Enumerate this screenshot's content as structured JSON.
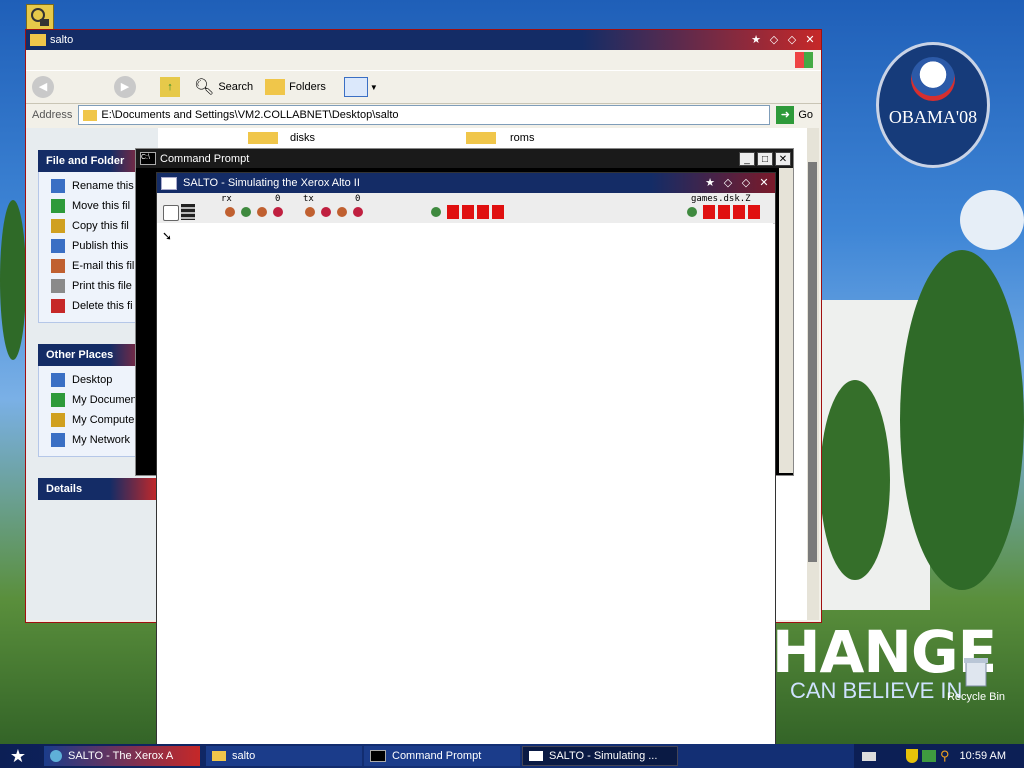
{
  "desktop": {
    "recycle_bin_label": "Recycle Bin",
    "poster_change": "HANGE",
    "poster_believe": "CAN BELIEVE IN",
    "badge_text": "OBAMA'08"
  },
  "explorer": {
    "title": "salto",
    "toolbar": {
      "search": "Search",
      "folders": "Folders"
    },
    "address_label": "Address",
    "address_value": "E:\\Documents and Settings\\VM2.COLLABNET\\Desktop\\salto",
    "go_label": "Go",
    "folders": [
      "disks",
      "roms"
    ],
    "file_tasks": {
      "header": "File and Folder",
      "items": [
        {
          "label": "Rename this",
          "icon": "rename-icon"
        },
        {
          "label": "Move this fil",
          "icon": "move-icon"
        },
        {
          "label": "Copy this fil",
          "icon": "copy-icon"
        },
        {
          "label": "Publish this",
          "icon": "publish-icon"
        },
        {
          "label": "E-mail this fil",
          "icon": "email-icon"
        },
        {
          "label": "Print this file",
          "icon": "print-icon"
        },
        {
          "label": "Delete this fi",
          "icon": "delete-icon"
        }
      ]
    },
    "other_places": {
      "header": "Other Places",
      "items": [
        {
          "label": "Desktop",
          "icon": "desktop-icon"
        },
        {
          "label": "My Documen",
          "icon": "my-documents-icon"
        },
        {
          "label": "My Compute",
          "icon": "my-computer-icon"
        },
        {
          "label": "My Network",
          "icon": "network-icon"
        }
      ]
    },
    "details_header": "Details"
  },
  "cmd": {
    "title": "Command Prompt"
  },
  "salto": {
    "title": "SALTO - Simulating the Xerox Alto II",
    "rx_label": "rx",
    "rx_count": "0",
    "tx_label": "tx",
    "tx_count": "0",
    "disk_name": "games.dsk.Z"
  },
  "taskbar": {
    "tasks": [
      {
        "label": "SALTO - The Xerox A",
        "icon": "salto-icon"
      },
      {
        "label": "salto",
        "icon": "folder-icon"
      },
      {
        "label": "Command Prompt",
        "icon": "cmd-icon"
      },
      {
        "label": "SALTO - Simulating ...",
        "icon": "window-icon"
      }
    ],
    "clock": "10:59 AM"
  },
  "colors": {
    "accent_navy": "#142c66",
    "accent_red": "#c62828",
    "led_red": "#e01010"
  }
}
